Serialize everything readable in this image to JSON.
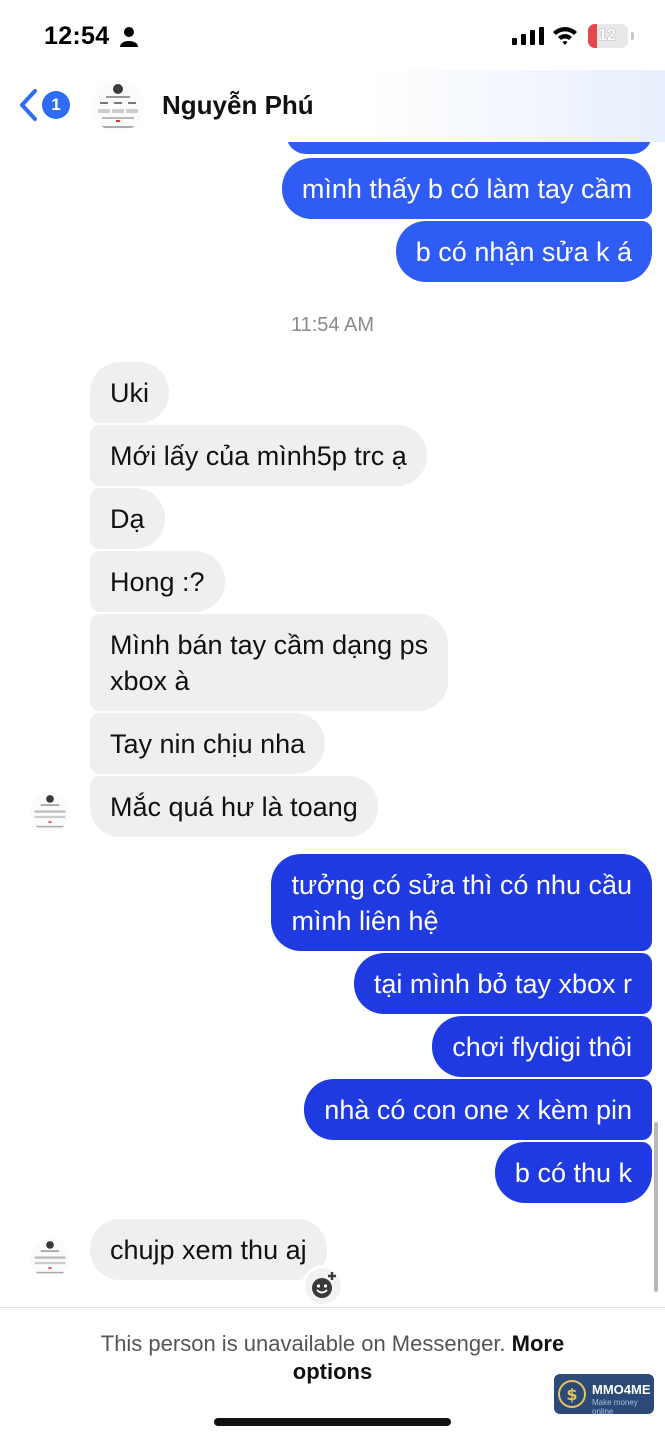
{
  "status_bar": {
    "time": "12:54",
    "battery": "12",
    "colors": {
      "battery_low": "#e5484d"
    }
  },
  "header": {
    "back_badge_count": "1",
    "contact_name": "Nguyễn Phú"
  },
  "messages": [
    {
      "side": "out",
      "text": "mình thấy b có làm tay cầm"
    },
    {
      "side": "out",
      "text": "b có nhận sửa k á"
    },
    {
      "type": "timestamp",
      "text": "11:54 AM"
    },
    {
      "side": "in",
      "text": "Uki"
    },
    {
      "side": "in",
      "text": "Mới lấy của mình5p trc ạ"
    },
    {
      "side": "in",
      "text": "Dạ"
    },
    {
      "side": "in",
      "text": "Hong :?"
    },
    {
      "side": "in",
      "lines": [
        "Mình bán tay cầm dạng ps",
        "xbox à"
      ]
    },
    {
      "side": "in",
      "text": "Tay nin chịu nha"
    },
    {
      "side": "in",
      "text": "Mắc quá hư là toang"
    },
    {
      "side": "out",
      "lines": [
        "tưởng có sửa thì có nhu cầu",
        "mình liên hệ"
      ]
    },
    {
      "side": "out",
      "text": "tại mình bỏ tay xbox r"
    },
    {
      "side": "out",
      "text": "chơi flydigi thôi"
    },
    {
      "side": "out",
      "text": "nhà có con one x kèm pin"
    },
    {
      "side": "out",
      "text": "b có thu k"
    },
    {
      "side": "in",
      "text": "chujp xem thu aj"
    }
  ],
  "footer": {
    "notice": "This person is unavailable on Messenger.",
    "link": "More options"
  },
  "watermark": {
    "brand": "MMO4ME",
    "tagline": "Make money online"
  },
  "icons": [
    "person-icon",
    "signal-icon",
    "wifi-icon",
    "battery-icon",
    "back-chevron-icon",
    "add-reaction-icon"
  ],
  "colors": {
    "outgoing_bubble": "#2f5cf4",
    "outgoing_bubble_dark": "#1e3ae0",
    "incoming_bubble": "#efefef",
    "accent": "#2d6cf3"
  }
}
